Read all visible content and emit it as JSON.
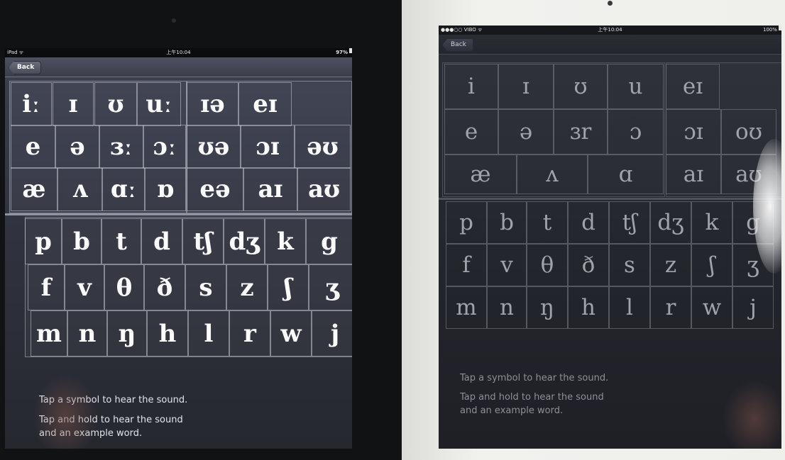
{
  "left": {
    "status": {
      "carrier": "iPad ᯤ",
      "time": "上午10:04",
      "battery": "97%",
      "battery_level": 0.97
    },
    "nav": {
      "back_label": "Back"
    },
    "vowels": [
      [
        "iː",
        "ɪ",
        "ʊ",
        "uː",
        "ɪə",
        "eɪ"
      ],
      [
        "e",
        "ə",
        "ɜː",
        "ɔː",
        "ʊə",
        "ɔɪ",
        "əʊ"
      ],
      [
        "æ",
        "ʌ",
        "ɑː",
        "ɒ",
        "eə",
        "aɪ",
        "aʊ"
      ]
    ],
    "consonants": [
      [
        "p",
        "b",
        "t",
        "d",
        "tʃ",
        "dʒ",
        "k",
        "g"
      ],
      [
        "f",
        "v",
        "θ",
        "ð",
        "s",
        "z",
        "ʃ",
        "ʒ"
      ],
      [
        "m",
        "n",
        "ŋ",
        "h",
        "l",
        "r",
        "w",
        "j"
      ]
    ],
    "hint_tap": "Tap a symbol to hear the sound.",
    "hint_hold_1": "Tap and hold to hear the sound",
    "hint_hold_2": "and an example word."
  },
  "right": {
    "status": {
      "carrier": "●●●○○ VIBO ᯤ",
      "time": "上午10:04",
      "battery": "100%",
      "battery_level": 1.0
    },
    "nav": {
      "back_label": "Back"
    },
    "vowels": [
      [
        "i",
        "ɪ",
        "ʊ",
        "u",
        "eɪ"
      ],
      [
        "e",
        "ə",
        "ɜr",
        "ɔ",
        "ɔɪ",
        "oʊ"
      ],
      [
        "æ",
        "ʌ",
        "ɑ",
        "aɪ",
        "aʊ"
      ]
    ],
    "consonants": [
      [
        "p",
        "b",
        "t",
        "d",
        "tʃ",
        "dʒ",
        "k",
        "g"
      ],
      [
        "f",
        "v",
        "θ",
        "ð",
        "s",
        "z",
        "ʃ",
        "ʒ"
      ],
      [
        "m",
        "n",
        "ŋ",
        "h",
        "l",
        "r",
        "w",
        "j"
      ]
    ],
    "hint_tap": "Tap a symbol to hear the sound.",
    "hint_hold_1": "Tap and hold to hear the sound",
    "hint_hold_2": "and an example word."
  }
}
